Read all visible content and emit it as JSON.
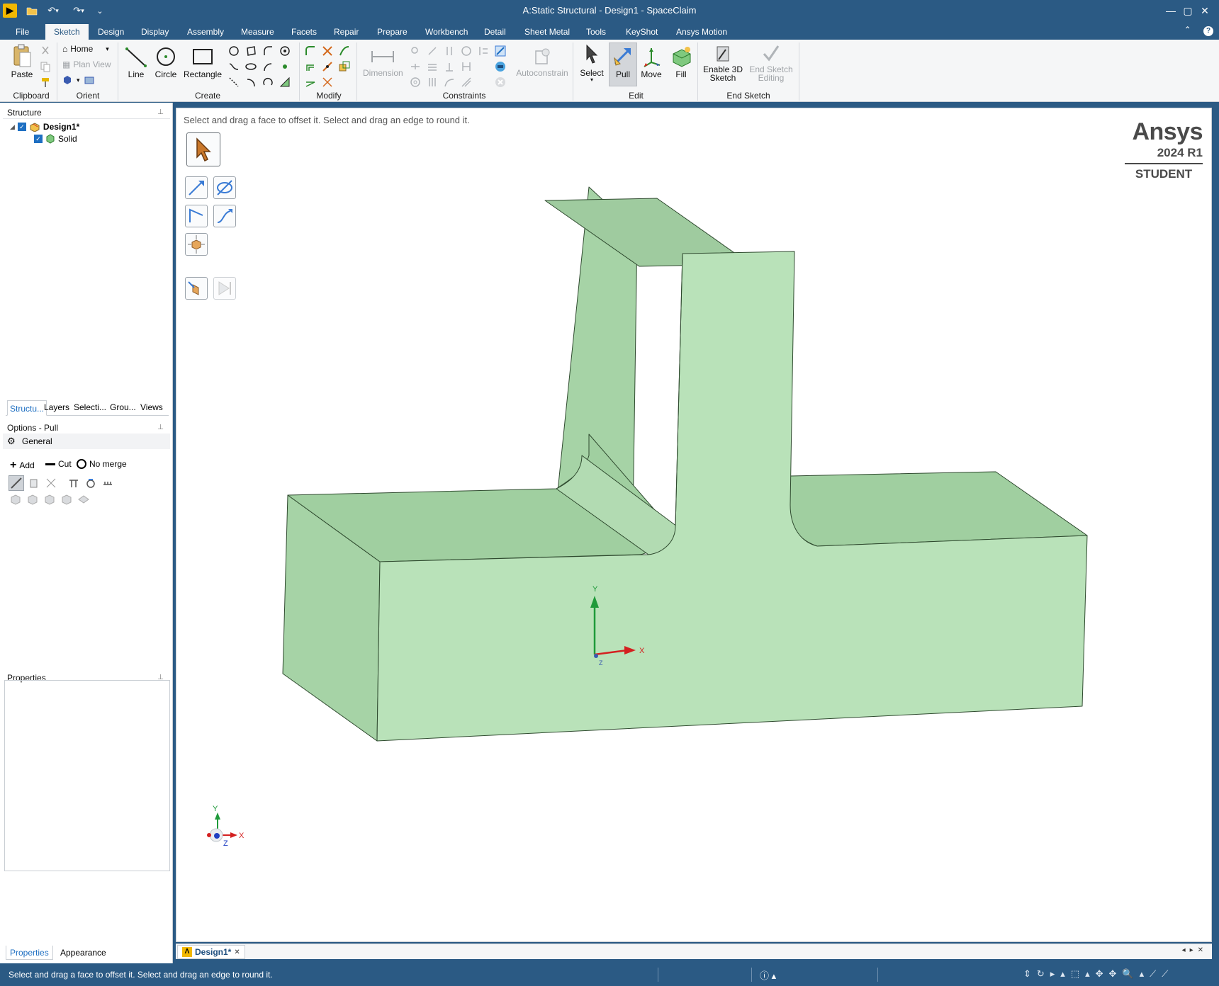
{
  "window": {
    "title": "A:Static Structural - Design1 - SpaceClaim",
    "minimize": "—",
    "maximize": "▢",
    "close": "✕"
  },
  "quick_access": {
    "file_icon": "folder-open-icon",
    "undo_icon": "undo-icon",
    "redo_icon": "redo-icon",
    "customize": "⌄"
  },
  "tabs": [
    "File",
    "Sketch",
    "Design",
    "Display",
    "Assembly",
    "Measure",
    "Facets",
    "Repair",
    "Prepare",
    "Workbench",
    "Detail",
    "Sheet Metal",
    "Tools",
    "KeyShot",
    "Ansys Motion"
  ],
  "active_tab": "Sketch",
  "ribbon": {
    "clipboard": {
      "label": "Clipboard",
      "paste": "Paste"
    },
    "orient": {
      "label": "Orient",
      "home": "Home",
      "plan_view": "Plan View"
    },
    "create": {
      "label": "Create",
      "line": "Line",
      "circle": "Circle",
      "rectangle": "Rectangle"
    },
    "modify": {
      "label": "Modify"
    },
    "constraints": {
      "label": "Constraints",
      "dimension": "Dimension",
      "autoconstrain": "Autoconstrain"
    },
    "edit": {
      "label": "Edit",
      "select": "Select",
      "pull": "Pull",
      "move": "Move",
      "fill": "Fill"
    },
    "end_sketch": {
      "label": "End Sketch",
      "enable_3d_1": "Enable 3D",
      "enable_3d_2": "Sketch",
      "end_editing_1": "End Sketch",
      "end_editing_2": "Editing"
    }
  },
  "structure": {
    "title": "Structure",
    "root": "Design1*",
    "child": "Solid"
  },
  "panel_tabs": [
    "Structu...",
    "Layers",
    "Selecti...",
    "Grou...",
    "Views"
  ],
  "options": {
    "title": "Options - Pull",
    "general": "General",
    "add": "Add",
    "cut": "Cut",
    "no_merge": "No merge"
  },
  "properties": {
    "title": "Properties"
  },
  "bottom_tabs": [
    "Properties",
    "Appearance"
  ],
  "viewport": {
    "hint": "Select and drag a face to offset it. Select and drag an edge to round it.",
    "brand_line1": "Ansys",
    "brand_line2": "2024 R1",
    "brand_line3": "STUDENT",
    "axis_x": "X",
    "axis_y": "Y",
    "axis_z": "Z",
    "model_color": "#b9e2b9"
  },
  "doc_tab": {
    "label": "Design1*",
    "close": "✕"
  },
  "status": {
    "message": "Select and drag a face to offset it. Select and drag an edge to round it."
  }
}
